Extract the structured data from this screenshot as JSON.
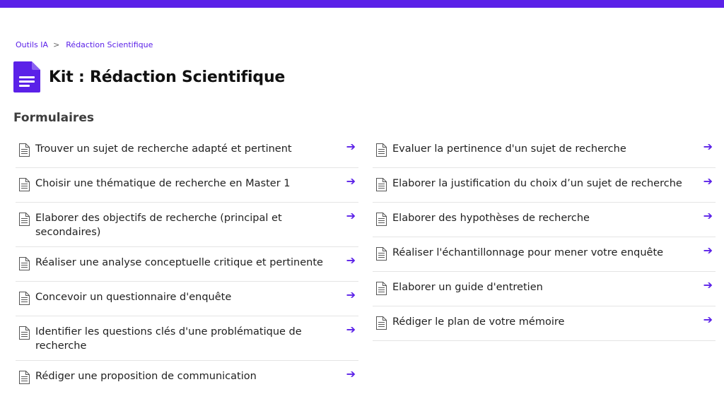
{
  "colors": {
    "accent": "#5b21e8",
    "divider": "#e4e4e4"
  },
  "breadcrumb": {
    "items": [
      {
        "label": "Outils IA"
      },
      {
        "label": "Rédaction Scientifique"
      }
    ],
    "separator": ">"
  },
  "header": {
    "icon": "document-icon",
    "title": "Kit : Rédaction Scientifique"
  },
  "section": {
    "title": "Formulaires"
  },
  "forms": {
    "left": [
      {
        "label": "Trouver un sujet de recherche adapté et pertinent",
        "icon": "document-outline-icon",
        "action_icon": "arrow-right-icon"
      },
      {
        "label": "Choisir une thématique de recherche en Master 1",
        "icon": "document-outline-icon",
        "action_icon": "arrow-right-icon"
      },
      {
        "label": "Elaborer des objectifs de recherche (principal et secondaires)",
        "icon": "document-outline-icon",
        "action_icon": "arrow-right-icon"
      },
      {
        "label": "Réaliser une analyse conceptuelle critique et pertinente",
        "icon": "document-outline-icon",
        "action_icon": "arrow-right-icon"
      },
      {
        "label": "Concevoir un questionnaire d'enquête",
        "icon": "document-outline-icon",
        "action_icon": "arrow-right-icon"
      },
      {
        "label": "Identifier les questions clés d'une problématique de recherche",
        "icon": "document-outline-icon",
        "action_icon": "arrow-right-icon"
      },
      {
        "label": "Rédiger une proposition de communication",
        "icon": "document-outline-icon",
        "action_icon": "arrow-right-icon"
      }
    ],
    "right": [
      {
        "label": "Evaluer la pertinence d'un sujet de recherche",
        "icon": "document-outline-icon",
        "action_icon": "arrow-right-icon"
      },
      {
        "label": "Elaborer la justification du choix d’un sujet de recherche",
        "icon": "document-outline-icon",
        "action_icon": "arrow-right-icon"
      },
      {
        "label": "Elaborer des hypothèses de recherche",
        "icon": "document-outline-icon",
        "action_icon": "arrow-right-icon"
      },
      {
        "label": "Réaliser l'échantillonnage pour mener votre enquête",
        "icon": "document-outline-icon",
        "action_icon": "arrow-right-icon"
      },
      {
        "label": "Elaborer un guide d'entretien",
        "icon": "document-outline-icon",
        "action_icon": "arrow-right-icon"
      },
      {
        "label": "Rédiger le plan de votre mémoire",
        "icon": "document-outline-icon",
        "action_icon": "arrow-right-icon"
      }
    ]
  },
  "arrow_glyph": "➔"
}
